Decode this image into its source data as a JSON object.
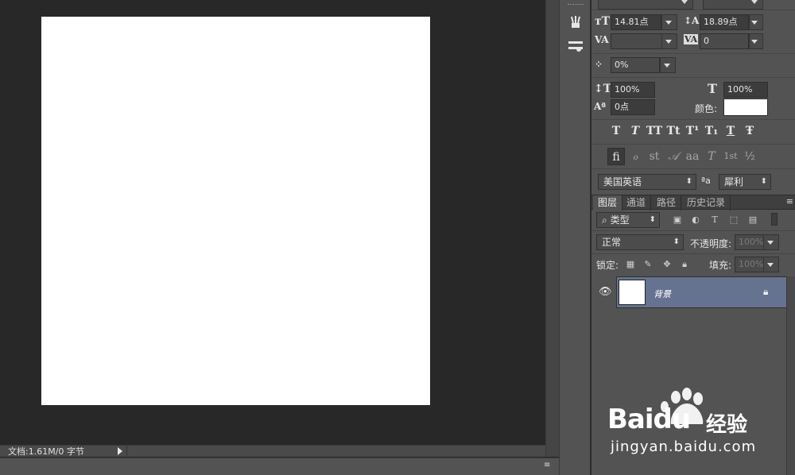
{
  "status_bar": {
    "doc_info": "文档:1.61M/0 字节"
  },
  "character_panel": {
    "font_size": "14.81点",
    "leading": "18.89点",
    "kerning": "",
    "tracking": "0",
    "tsume": "0%",
    "vertical_scale": "100%",
    "horizontal_scale": "100%",
    "baseline_shift": "0点",
    "color_label": "颜色:",
    "color_value": "#ffffff",
    "style_buttons": [
      "T",
      "T",
      "TT",
      "Tt",
      "T¹",
      "T₁",
      "T",
      "Ŧ"
    ],
    "opentype_buttons": [
      "ﬁ",
      "ℴ",
      "st",
      "𝒜",
      "aa",
      "T",
      "1st",
      "½"
    ],
    "language": "美国英语",
    "aa_icon": "ªa",
    "antialias": "犀利"
  },
  "layers_panel": {
    "tabs": [
      "图层",
      "通道",
      "路径",
      "历史记录"
    ],
    "active_tab": "图层",
    "filter_kind": "类型",
    "blend_mode": "正常",
    "opacity_label": "不透明度:",
    "opacity_value": "100%",
    "lock_label": "锁定:",
    "fill_label": "填充:",
    "fill_value": "100%",
    "layers": [
      {
        "name": "背景",
        "visible": true,
        "locked": true,
        "selected": true
      }
    ]
  },
  "watermark": {
    "brand": "Baidu",
    "brand_cn": "经验",
    "url": "jingyan.baidu.com"
  },
  "colors": {
    "selection": "#657390",
    "panel": "#535353",
    "canvas_bg": "#282828"
  }
}
